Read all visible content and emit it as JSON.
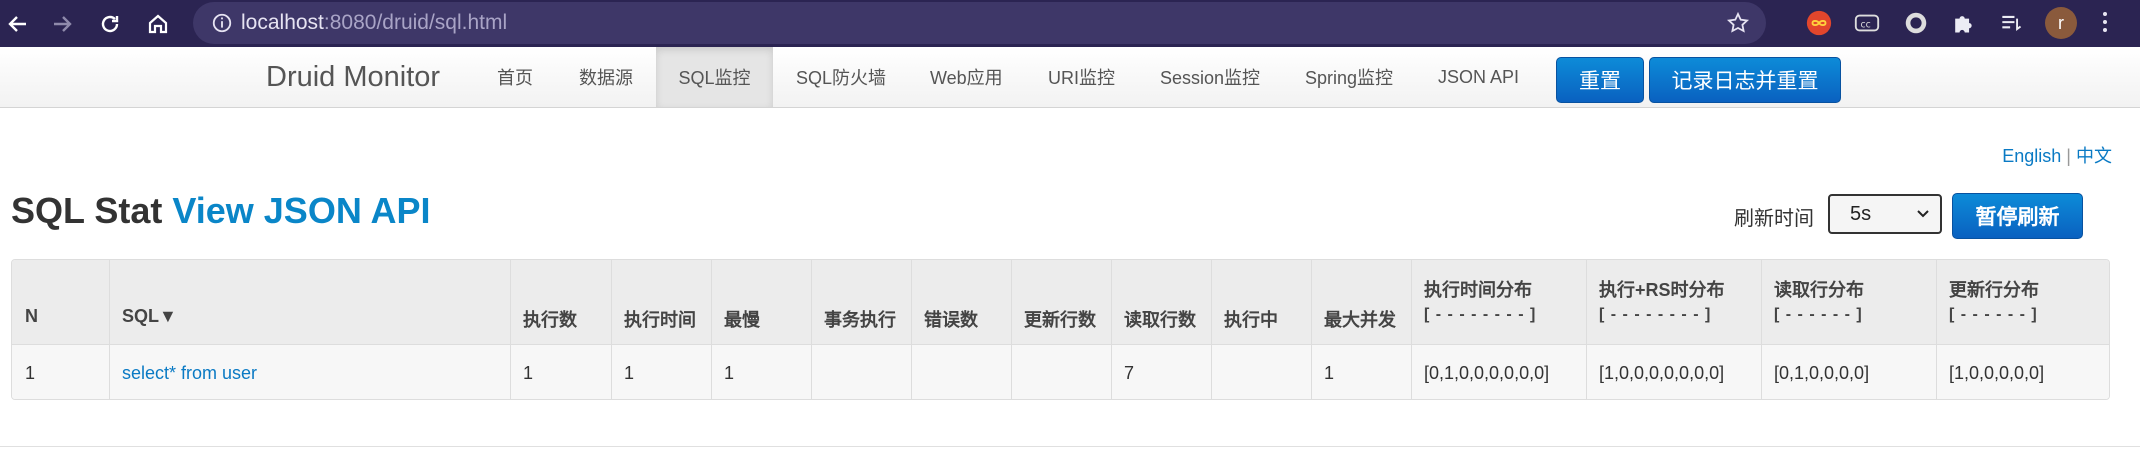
{
  "browser": {
    "url_host": "localhost",
    "url_path": ":8080/druid/sql.html",
    "profile_initial": "r"
  },
  "navbar": {
    "brand": "Druid Monitor",
    "items": [
      "首页",
      "数据源",
      "SQL监控",
      "SQL防火墙",
      "Web应用",
      "URI监控",
      "Session监控",
      "Spring监控",
      "JSON API"
    ],
    "active_index": 2,
    "reset_label": "重置",
    "log_reset_label": "记录日志并重置"
  },
  "lang": {
    "english": "English",
    "separator": "|",
    "chinese": "中文"
  },
  "page": {
    "title_prefix": "SQL Stat",
    "title_link": "View JSON API",
    "refresh_label": "刷新时间",
    "refresh_value": "5s",
    "stop_refresh_label": "暂停刷新"
  },
  "table": {
    "headers": [
      "N",
      "SQL▼",
      "执行数",
      "执行时间",
      "最慢",
      "事务执行",
      "错误数",
      "更新行数",
      "读取行数",
      "执行中",
      "最大并发",
      "执行时间分布",
      "执行+RS时分布",
      "读取行分布",
      "更新行分布"
    ],
    "header_subs": [
      "[ - - - - - - - - ]",
      "[ - - - - - - - - ]",
      "[ - - - - - - ]",
      "[ - - - - - - ]"
    ],
    "rows": [
      [
        "1",
        "select* from user",
        "1",
        "1",
        "1",
        "",
        "",
        "",
        "7",
        "",
        "1",
        "[0,1,0,0,0,0,0,0]",
        "[1,0,0,0,0,0,0,0]",
        "[0,1,0,0,0,0]",
        "[1,0,0,0,0,0]"
      ]
    ]
  },
  "colors": {
    "chrome_bg": "#2b2452",
    "accent_blue": "#0a7ac4",
    "button_blue": "#0a6fc8"
  }
}
